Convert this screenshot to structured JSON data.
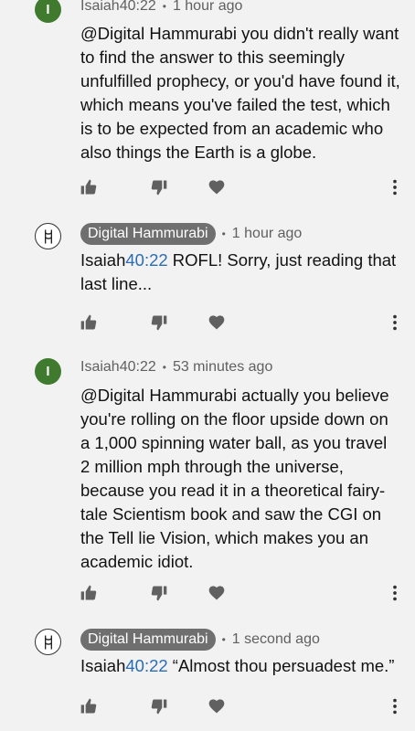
{
  "comments": [
    {
      "author": "Isaiah40:22",
      "time": "1 hour ago",
      "avatar_letter": "I",
      "text": "@Digital Hammurabi you didn't really want to find the answer to this seemingly unfulfilled prophecy, or you'd have found it, which means you've failed the test, which is to be expected from an academic who also things the Earth is a globe."
    },
    {
      "author": "Digital Hammurabi",
      "time": "1 hour ago",
      "text_prefix": "Isaiah",
      "text_link": "40:22",
      "text_suffix": " ROFL! Sorry, just reading that last line..."
    },
    {
      "author": "Isaiah40:22",
      "time": "53 minutes ago",
      "avatar_letter": "I",
      "text": "@Digital Hammurabi actually you believe you're rolling on the floor upside down on a 1,000 spinning water ball, as you travel 2 million mph through the universe, because you read it in a theoretical fairy-tale Scientism book and saw the CGI on the Tell lie Vision, which makes you an academic idiot."
    },
    {
      "author": "Digital Hammurabi",
      "time": "1 second ago",
      "text_prefix": "Isaiah",
      "text_link": "40:22",
      "text_suffix": " “Almost thou persuadest me.”"
    }
  ],
  "header_separator": "•",
  "colors": {
    "avatar_green": "#3f7a2e",
    "pill_gray": "#6f6f6f",
    "link_blue": "#2a6db3",
    "background": "#f2f2f2"
  },
  "icons": [
    "thumbs-up-icon",
    "thumbs-down-icon",
    "heart-icon",
    "more-vert-icon"
  ]
}
